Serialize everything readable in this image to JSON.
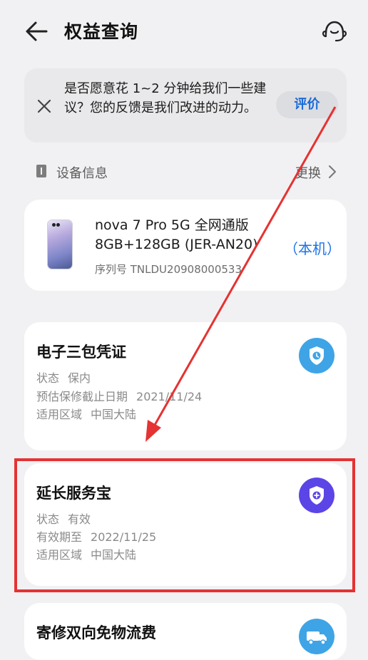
{
  "header": {
    "title": "权益查询",
    "back_icon": "arrow-left-icon",
    "service_icon": "customer-service-icon"
  },
  "feedback": {
    "text": "是否愿意花 1~2 分钟给我们一些建议？您的反馈是我们改进的动力。",
    "button_label": "评价"
  },
  "device_section": {
    "label": "设备信息",
    "change_label": "更换"
  },
  "device": {
    "name_line1": "nova 7 Pro 5G 全网通版",
    "name_line2": "8GB+128GB (JER-AN20)",
    "local_tag": "（本机）",
    "serial": "序列号 TNLDU20908000533"
  },
  "cards": [
    {
      "title": "电子三包凭证",
      "rows": [
        {
          "label": "状态",
          "value": "保内"
        },
        {
          "label": "预估保修截止日期",
          "value": "2021/11/24"
        },
        {
          "label": "适用区域",
          "value": "中国大陆"
        }
      ]
    },
    {
      "title": "延长服务宝",
      "rows": [
        {
          "label": "状态",
          "value": "有效"
        },
        {
          "label": "有效期至",
          "value": "2022/11/25"
        },
        {
          "label": "适用区域",
          "value": "中国大陆"
        }
      ]
    },
    {
      "title": "寄修双向免物流费",
      "rows": []
    }
  ],
  "colors": {
    "accent": "#1a73e8",
    "highlight": "#e53232",
    "badge_blue": "#3ea4e6",
    "badge_purple": "#5c45e6"
  }
}
